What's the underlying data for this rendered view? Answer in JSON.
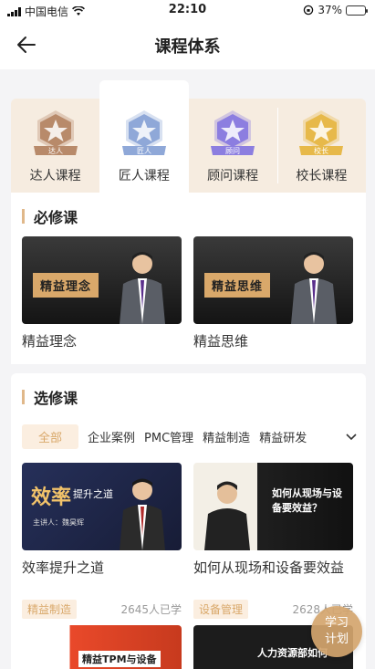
{
  "status_bar": {
    "carrier": "中国电信",
    "time": "22:10",
    "battery": "37%",
    "battery_level": 0.37
  },
  "nav": {
    "title": "课程体系",
    "back_icon": "arrow-left-icon"
  },
  "levels": [
    {
      "label": "达人课程",
      "badge_text": "达人",
      "color": "#b88a6a",
      "active": false
    },
    {
      "label": "匠人课程",
      "badge_text": "匠人",
      "color": "#8fa8d8",
      "active": true
    },
    {
      "label": "顾问课程",
      "badge_text": "顾问",
      "color": "#8c7ee0",
      "active": false
    },
    {
      "label": "校长课程",
      "badge_text": "校长",
      "color": "#e7b94a",
      "active": false
    }
  ],
  "required": {
    "title": "必修课",
    "courses": [
      {
        "title": "精益理念",
        "thumb_text": "精益理念"
      },
      {
        "title": "精益思维",
        "thumb_text": "精益思维"
      }
    ]
  },
  "elective": {
    "title": "选修课",
    "categories": [
      "全部",
      "企业案例",
      "PMC管理",
      "精益制造",
      "精益研发"
    ],
    "courses": [
      {
        "title": "效率提升之道",
        "thumb_big": "效率",
        "thumb_small": "提升之道",
        "thumb_speaker": "主讲人：魏昊辉"
      },
      {
        "title": "如何从现场和设备要效益",
        "thumb_text": "如何从现场与设备要效益？"
      }
    ],
    "tagged": [
      {
        "tag": "精益制造",
        "learners": "2645人已学",
        "thumb_text": "精益TPM与设备"
      },
      {
        "tag": "设备管理",
        "learners": "2628人已学",
        "thumb_text": "人力资源部如何"
      }
    ]
  },
  "fab": {
    "line1": "学习",
    "line2": "计划"
  }
}
